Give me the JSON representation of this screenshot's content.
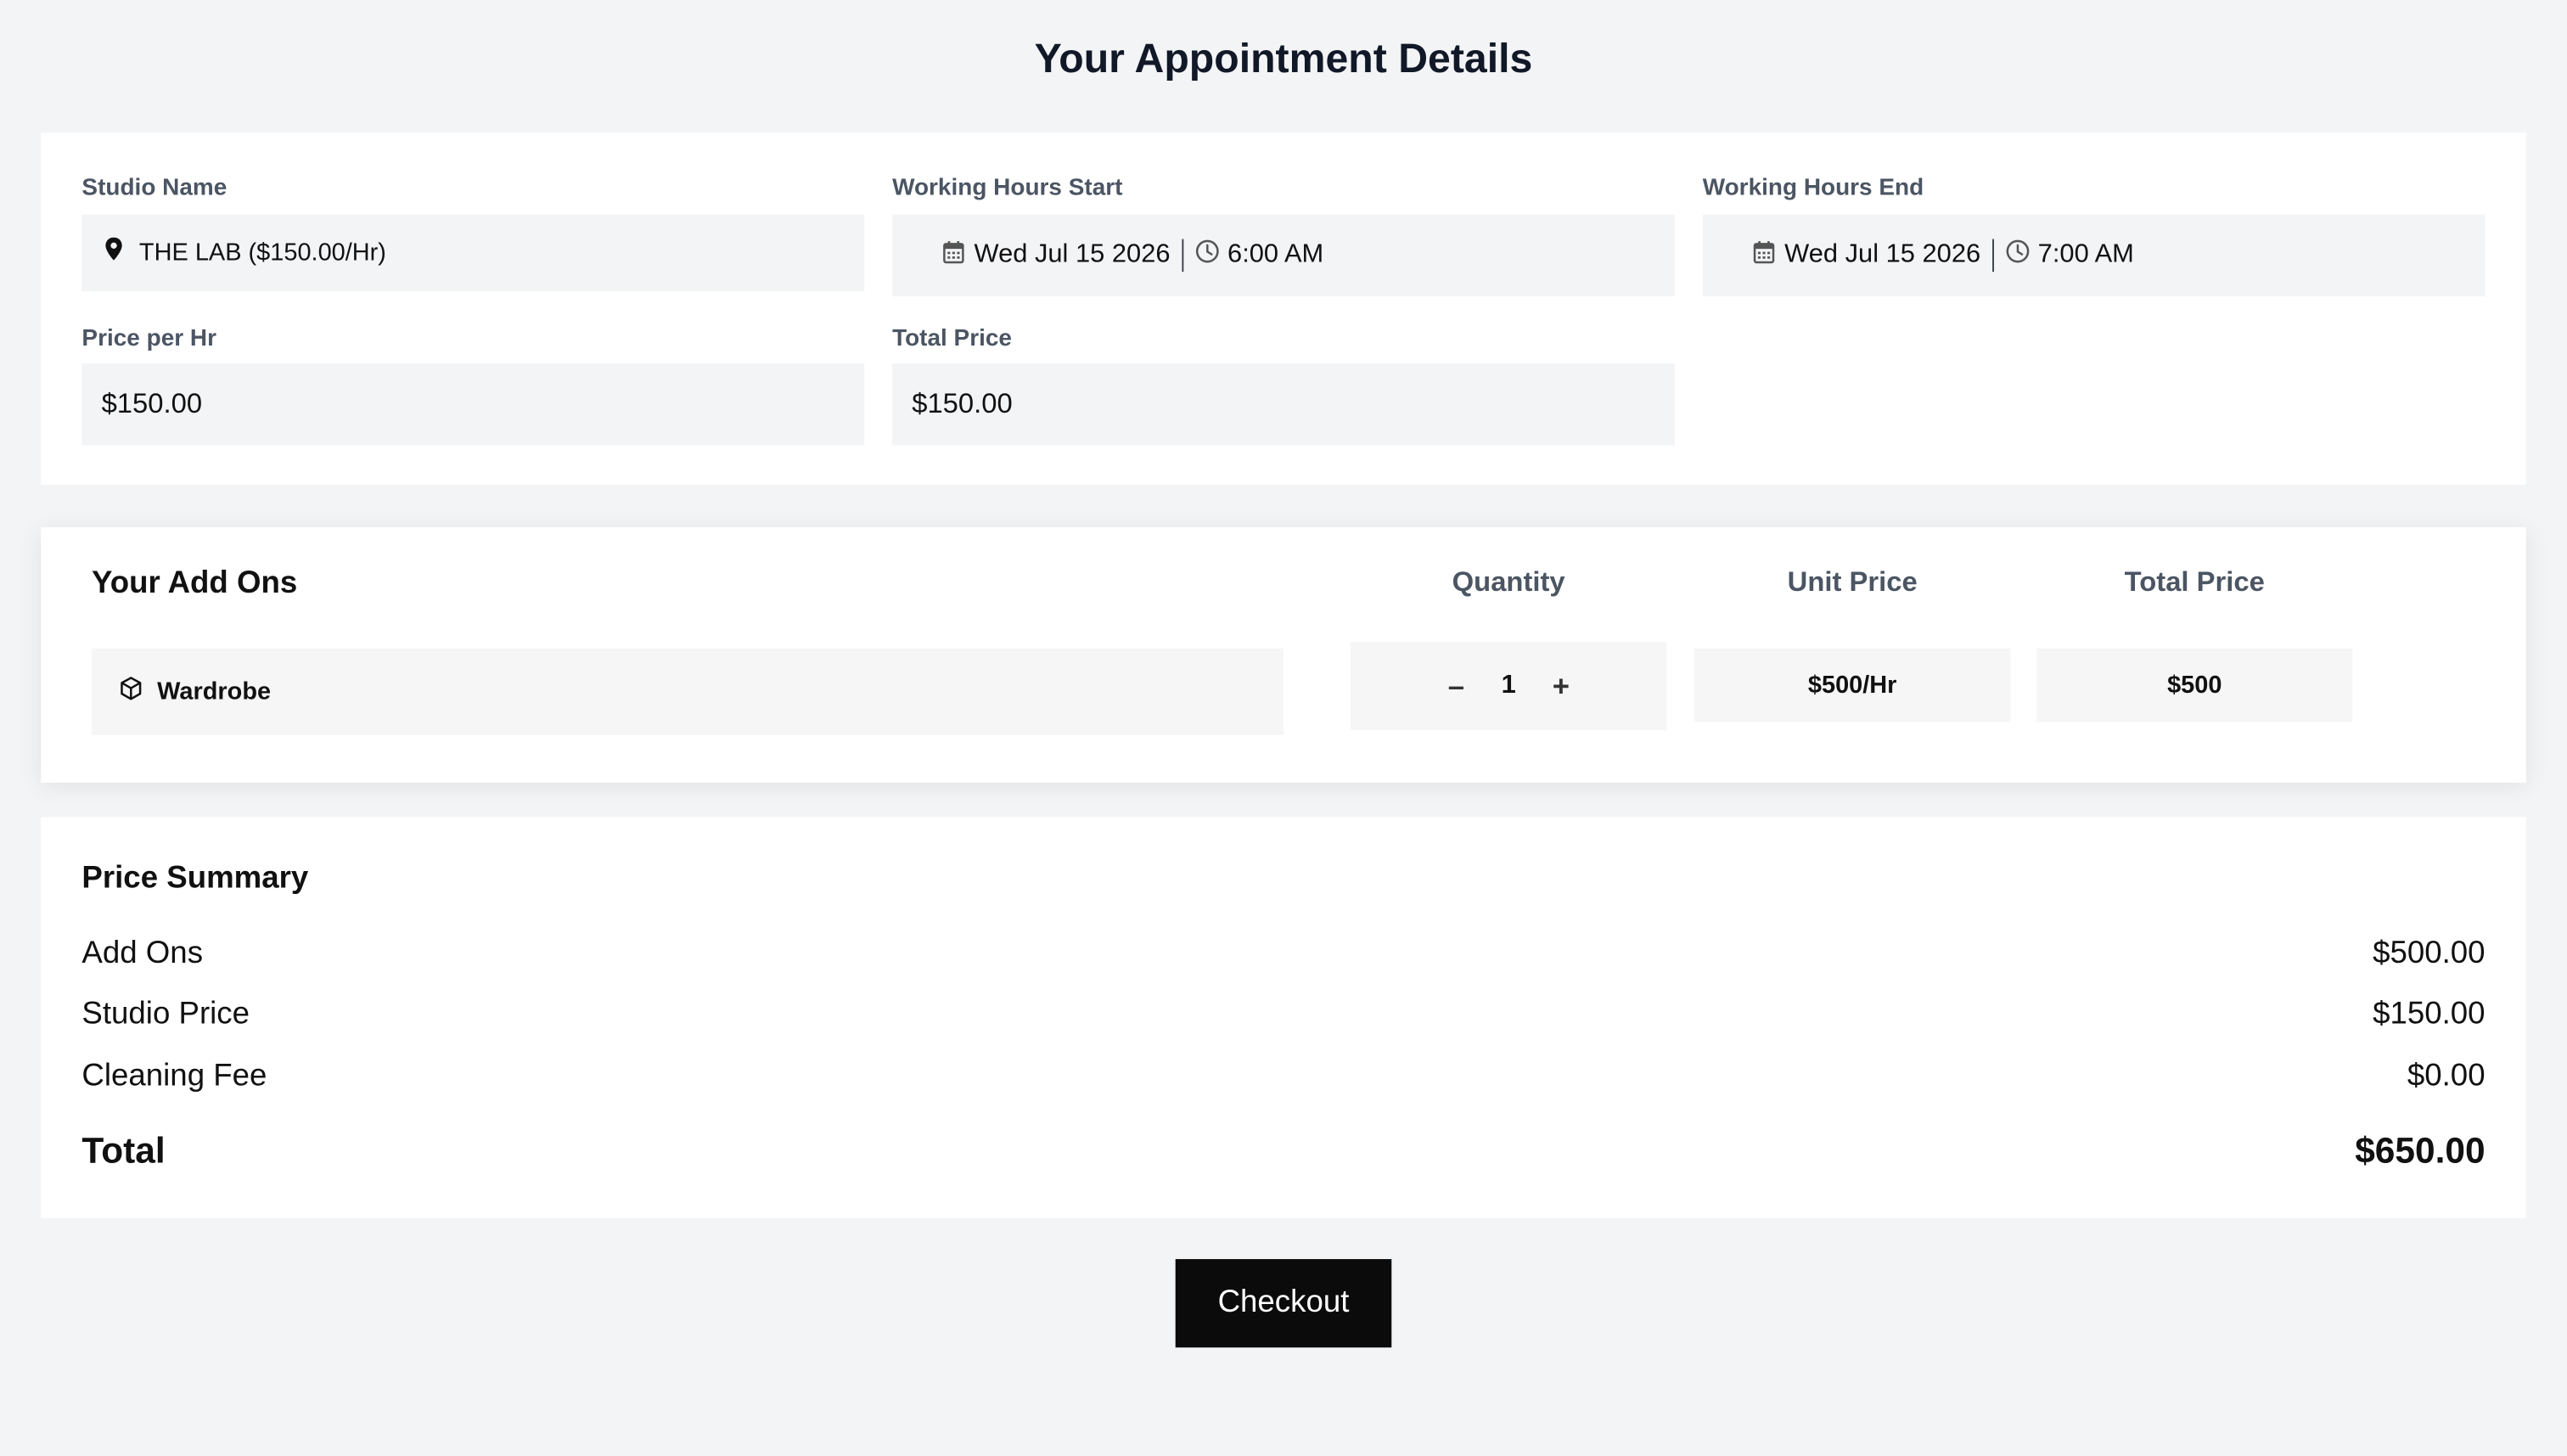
{
  "page": {
    "title": "Your Appointment Details"
  },
  "details": {
    "studio_name": {
      "label": "Studio Name",
      "value": "THE LAB ($150.00/Hr)",
      "icon": "map-pin-icon"
    },
    "hours_start": {
      "label": "Working Hours Start",
      "date": "Wed Jul 15 2026",
      "time": "6:00 AM",
      "date_icon": "calendar-icon",
      "time_icon": "clock-icon"
    },
    "hours_end": {
      "label": "Working Hours End",
      "date": "Wed Jul 15 2026",
      "time": "7:00 AM",
      "date_icon": "calendar-icon",
      "time_icon": "clock-icon"
    },
    "price_per_hr": {
      "label": "Price per Hr",
      "value": "$150.00"
    },
    "total_price": {
      "label": "Total Price",
      "value": "$150.00"
    }
  },
  "addons": {
    "title": "Your Add Ons",
    "columns": {
      "quantity": "Quantity",
      "unit_price": "Unit Price",
      "total_price": "Total Price"
    },
    "items": [
      {
        "name": "Wardrobe",
        "icon": "box-icon",
        "decrement": "–",
        "quantity": "1",
        "increment": "+",
        "unit_price": "$500/Hr",
        "total_price": "$500"
      }
    ]
  },
  "summary": {
    "title": "Price Summary",
    "rows": [
      {
        "label": "Add Ons",
        "value": "$500.00"
      },
      {
        "label": "Studio Price",
        "value": "$150.00"
      },
      {
        "label": "Cleaning Fee",
        "value": "$0.00"
      }
    ],
    "total": {
      "label": "Total",
      "value": "$650.00"
    }
  },
  "actions": {
    "checkout_label": "Checkout"
  },
  "colors": {
    "page_background": "#f3f4f6",
    "card_background": "#ffffff",
    "field_background": "#f3f4f6",
    "label_text": "#4b5563",
    "button_background": "#0b0b0b",
    "button_text": "#ffffff"
  }
}
